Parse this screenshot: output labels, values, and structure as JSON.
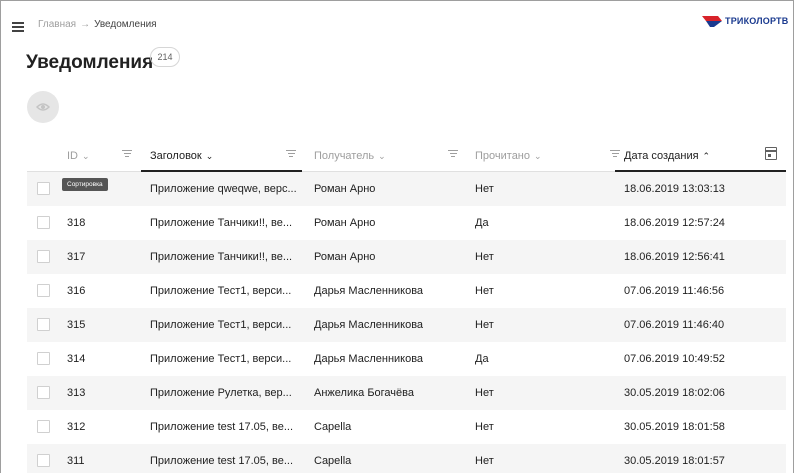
{
  "breadcrumb": {
    "home": "Главная",
    "separator": "→",
    "current": "Уведомления"
  },
  "logo": {
    "text": "ТРИКОЛОРТВ",
    "colors": {
      "red": "#d8232a",
      "blue": "#1a3a8f"
    }
  },
  "page": {
    "title": "Уведомления",
    "count": "214"
  },
  "toolbar": {
    "eye_icon": "eye-icon"
  },
  "tooltip": {
    "text": "Сортировка"
  },
  "table": {
    "columns": [
      {
        "label": "ID",
        "sort": "down",
        "active": false
      },
      {
        "label": "Заголовок",
        "sort": "down",
        "active": true
      },
      {
        "label": "Получатель",
        "sort": "down",
        "active": false
      },
      {
        "label": "Прочитано",
        "sort": "down",
        "active": false
      },
      {
        "label": "Дата создания",
        "sort": "up",
        "active": true
      }
    ],
    "rows": [
      {
        "id": "",
        "title": "Приложение qweqwe, верс...",
        "recipient": "Роман Арно",
        "read": "Нет",
        "created": "18.06.2019 13:03:13"
      },
      {
        "id": "318",
        "title": "Приложение Танчики!!, ве...",
        "recipient": "Роман Арно",
        "read": "Да",
        "created": "18.06.2019 12:57:24"
      },
      {
        "id": "317",
        "title": "Приложение Танчики!!, ве...",
        "recipient": "Роман Арно",
        "read": "Нет",
        "created": "18.06.2019 12:56:41"
      },
      {
        "id": "316",
        "title": "Приложение Тест1, верси...",
        "recipient": "Дарья Масленникова",
        "read": "Нет",
        "created": "07.06.2019 11:46:56"
      },
      {
        "id": "315",
        "title": "Приложение Тест1, верси...",
        "recipient": "Дарья Масленникова",
        "read": "Нет",
        "created": "07.06.2019 11:46:40"
      },
      {
        "id": "314",
        "title": "Приложение Тест1, верси...",
        "recipient": "Дарья Масленникова",
        "read": "Да",
        "created": "07.06.2019 10:49:52"
      },
      {
        "id": "313",
        "title": "Приложение Рулетка, вер...",
        "recipient": "Анжелика Богачёва",
        "read": "Нет",
        "created": "30.05.2019 18:02:06"
      },
      {
        "id": "312",
        "title": "Приложение test 17.05, ве...",
        "recipient": "Capella",
        "read": "Нет",
        "created": "30.05.2019 18:01:58"
      },
      {
        "id": "311",
        "title": "Приложение test 17.05, ве...",
        "recipient": "Capella",
        "read": "Нет",
        "created": "30.05.2019 18:01:57"
      }
    ]
  }
}
